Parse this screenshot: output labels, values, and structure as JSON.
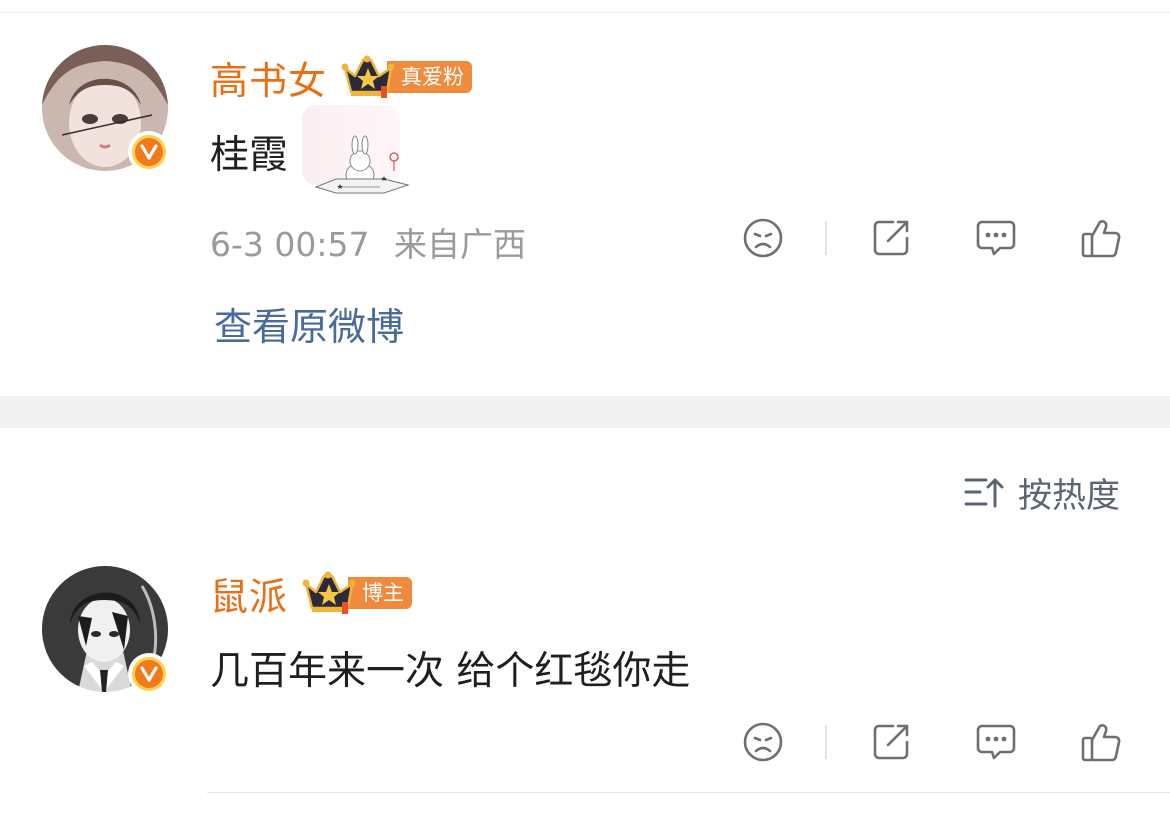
{
  "comments": [
    {
      "username": "高书女",
      "badge_label": "真爱粉",
      "text": "桂霞",
      "timestamp": "6-3 00:57",
      "location": "来自广西",
      "avatar_icon": "girl-portrait-avatar",
      "verified_icon": "v-verified-badge-icon",
      "sticker_icon": "bunny-sticker-decoration",
      "view_original_label": "查看原微博"
    },
    {
      "username": "鼠派",
      "badge_label": "博主",
      "text": "几百年来一次 给个红毯你走",
      "avatar_icon": "anime-boy-avatar",
      "verified_icon": "v-verified-badge-icon"
    }
  ],
  "sort": {
    "label": "按热度",
    "icon": "sort-by-heat-icon"
  },
  "actions": {
    "icons": [
      "sad-face-icon",
      "share-icon",
      "comment-icon",
      "like-icon"
    ]
  },
  "colors": {
    "username": "#e86f14",
    "badge_tag": "#f08a3c",
    "link": "#4a6a9c",
    "meta": "#9a9a9a",
    "verified": "#f07a1c"
  }
}
